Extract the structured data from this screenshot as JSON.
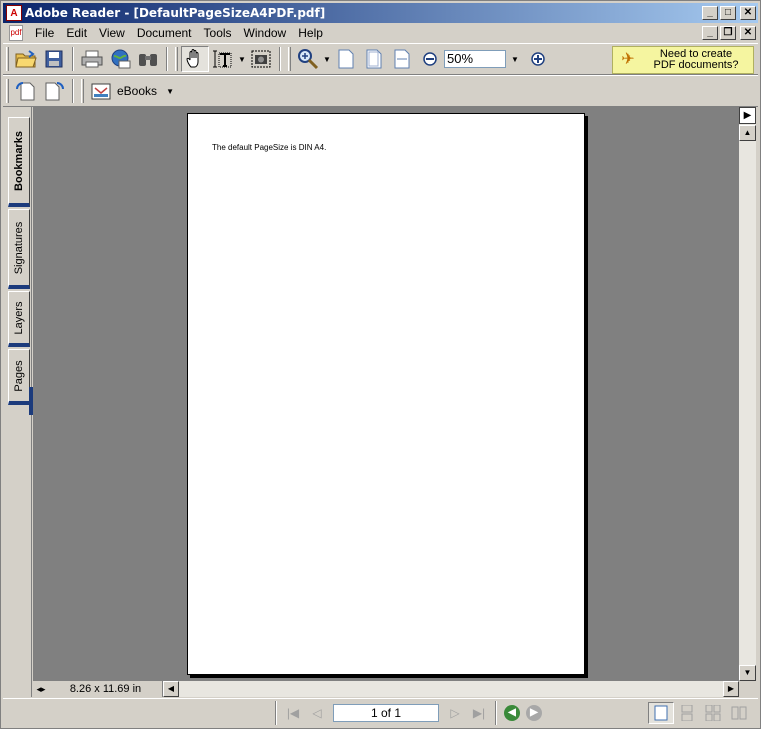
{
  "window": {
    "title": "Adobe Reader - [DefaultPageSizeA4PDF.pdf]"
  },
  "menu": [
    "File",
    "Edit",
    "View",
    "Document",
    "Tools",
    "Window",
    "Help"
  ],
  "toolbar": {
    "zoom_value": "50%",
    "promo_line1": "Need to create",
    "promo_line2": "PDF documents?",
    "ebooks_label": "eBooks"
  },
  "side_tabs": [
    "Bookmarks",
    "Signatures",
    "Layers",
    "Pages"
  ],
  "document": {
    "text": "The default PageSize is DIN A4."
  },
  "status": {
    "page_size": "8.26 x 11.69 in"
  },
  "navigation": {
    "page_indicator": "1 of 1"
  },
  "colors": {
    "title_start": "#0a246a",
    "title_end": "#a6caf0",
    "promo_bg": "#f5f5a0",
    "tab_accent": "#1c3b7c"
  }
}
